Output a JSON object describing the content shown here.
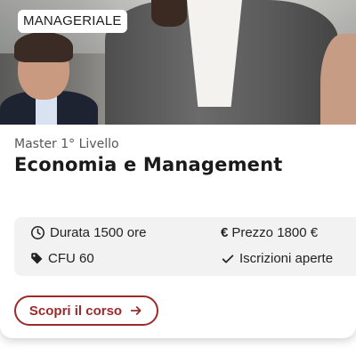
{
  "card": {
    "badge": "MANAGERIALE",
    "subtitle": "Master 1° Livello",
    "title": "Economia e Management",
    "info": {
      "duration": "Durata 1500 ore",
      "price": "Prezzo 1800 €",
      "price_symbol": "€",
      "credits": "CFU 60",
      "status": "Iscrizioni aperte"
    },
    "cta_label": "Scopri il corso"
  },
  "icons": [
    "clock-icon",
    "euro-icon",
    "tag-icon",
    "check-icon",
    "arrow-right-icon"
  ],
  "colors": {
    "accent": "#9b2a2a",
    "info_bg": "#f2f2f3",
    "title": "#1a1a1a",
    "subtitle": "#555555"
  }
}
